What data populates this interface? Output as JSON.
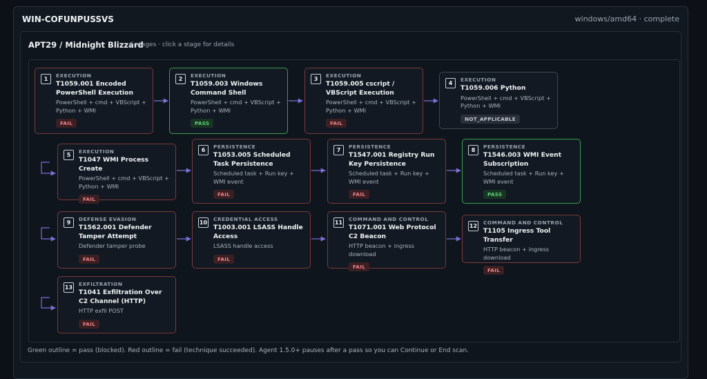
{
  "host": {
    "name": "WIN-COFUNPUSSVS",
    "meta": "windows/amd64 · complete"
  },
  "group": {
    "title": "APT29 / Midnight Blizzard",
    "subtitle": "6 stages · click a stage for details"
  },
  "stages": [
    {
      "num": "1",
      "category": "EXECUTION",
      "name": "T1059.001 Encoded PowerShell Execution",
      "desc": "PowerShell + cmd + VBScript + Python + WMI",
      "status": "FAIL"
    },
    {
      "num": "2",
      "category": "EXECUTION",
      "name": "T1059.003 Windows Command Shell",
      "desc": "PowerShell + cmd + VBScript + Python + WMI",
      "status": "PASS"
    },
    {
      "num": "3",
      "category": "EXECUTION",
      "name": "T1059.005 cscript / VBScript Execution",
      "desc": "PowerShell + cmd + VBScript + Python + WMI",
      "status": "FAIL"
    },
    {
      "num": "4",
      "category": "EXECUTION",
      "name": "T1059.006 Python",
      "desc": "PowerShell + cmd + VBScript + Python + WMI",
      "status": "NOT_APPLICABLE"
    },
    {
      "num": "5",
      "category": "EXECUTION",
      "name": "T1047 WMI Process Create",
      "desc": "PowerShell + cmd + VBScript + Python + WMI",
      "status": "FAIL"
    },
    {
      "num": "6",
      "category": "PERSISTENCE",
      "name": "T1053.005 Scheduled Task Persistence",
      "desc": "Scheduled task + Run key + WMI event",
      "status": "FAIL"
    },
    {
      "num": "7",
      "category": "PERSISTENCE",
      "name": "T1547.001 Registry Run Key Persistence",
      "desc": "Scheduled task + Run key + WMI event",
      "status": "FAIL"
    },
    {
      "num": "8",
      "category": "PERSISTENCE",
      "name": "T1546.003 WMI Event Subscription",
      "desc": "Scheduled task + Run key + WMI event",
      "status": "PASS"
    },
    {
      "num": "9",
      "category": "DEFENSE EVASION",
      "name": "T1562.001 Defender Tamper Attempt",
      "desc": "Defender tamper probe",
      "status": "FAIL"
    },
    {
      "num": "10",
      "category": "CREDENTIAL ACCESS",
      "name": "T1003.001 LSASS Handle Access",
      "desc": "LSASS handle access",
      "status": "FAIL"
    },
    {
      "num": "11",
      "category": "COMMAND AND CONTROL",
      "name": "T1071.001 Web Protocol C2 Beacon",
      "desc": "HTTP beacon + ingress download",
      "status": "FAIL"
    },
    {
      "num": "12",
      "category": "COMMAND AND CONTROL",
      "name": "T1105 Ingress Tool Transfer",
      "desc": "HTTP beacon + ingress download",
      "status": "FAIL"
    },
    {
      "num": "13",
      "category": "EXFILTRATION",
      "name": "T1041 Exfiltration Over C2 Channel (HTTP)",
      "desc": "HTTP exfil POST",
      "status": "FAIL"
    }
  ],
  "footer": "Green outline = pass (blocked). Red outline = fail (technique succeeded). Agent 1.5.0+ pauses after a pass so you can Continue or End scan.",
  "colors": {
    "pass": "#3aa04f",
    "fail": "#7a3a38",
    "na": "#3f4751",
    "connector": "#7a6fd8"
  }
}
